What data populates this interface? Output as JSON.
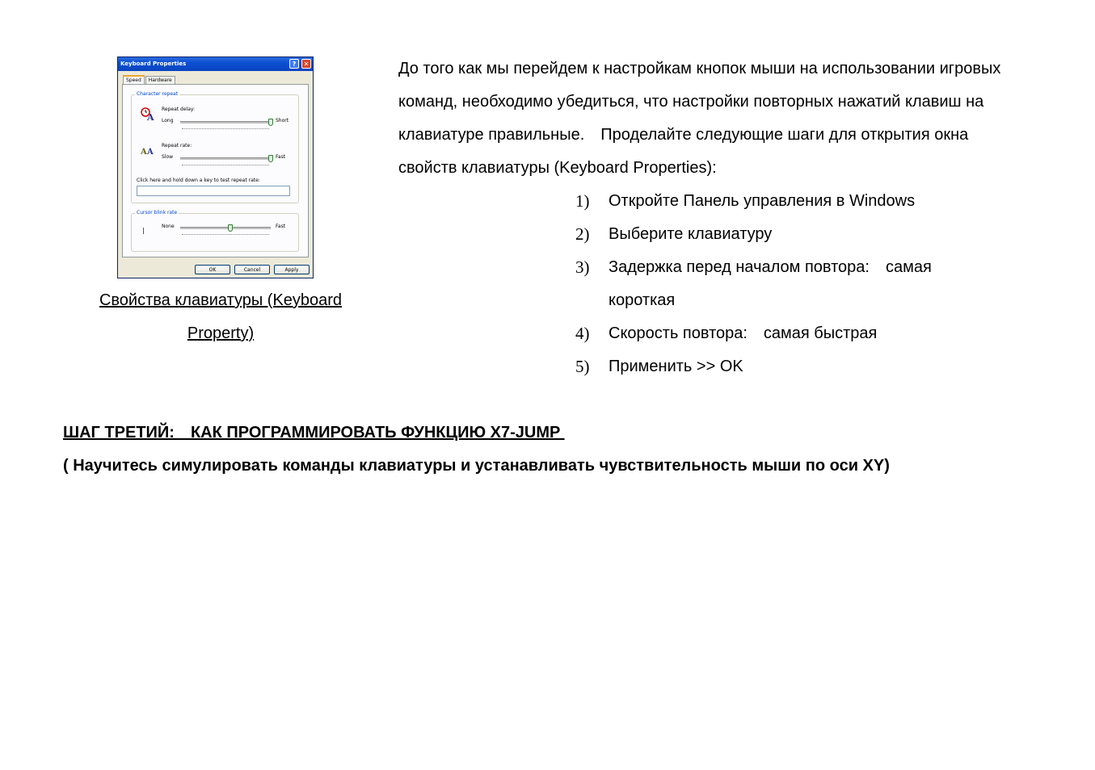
{
  "dialog": {
    "title": "Keyboard Properties",
    "help_glyph": "?",
    "close_glyph": "✕",
    "tabs": [
      "Speed",
      "Hardware"
    ],
    "character_repeat": {
      "group_label": "Character repeat",
      "repeat_delay_label": "Repeat delay:",
      "delay_min_label": "Long",
      "delay_max_label": "Short",
      "delay_level": 1.0,
      "repeat_rate_label": "Repeat rate:",
      "rate_min_label": "Slow",
      "rate_max_label": "Fast",
      "rate_level": 1.0,
      "test_label": "Click here and hold down a key to test repeat rate:",
      "delay_icon": "clock-letter-icon",
      "rate_icon": "repeated-letters-icon"
    },
    "cursor_blink": {
      "group_label": "Cursor blink rate",
      "min_label": "None",
      "max_label": "Fast",
      "cursor_glyph": "|",
      "blink_level": 0.55
    },
    "buttons": {
      "ok": "OK",
      "cancel": "Cancel",
      "apply": "Apply"
    }
  },
  "caption": {
    "line1": "Свойства клавиатуры (Keyboard ",
    "line2": "Property)"
  },
  "intro": "До того как мы перейдем к настройкам кнопок мыши на использовании игровых команд, необходимо убедиться, что настройки повторных нажатий клавиш на клавиатуре правильные.　Проделайте следующие шаги для открытия окна свойств клавиатуры (Keyboard Properties):",
  "steps": [
    {
      "num": "1)",
      "text": "Откройте Панель управления в Windows"
    },
    {
      "num": "2)",
      "text": "Выберите клавиатуру"
    },
    {
      "num": "3)",
      "text": "Задержка перед началом повтора:　самая короткая"
    },
    {
      "num": "4)",
      "text": "Скорость повтора:　самая быстрая"
    },
    {
      "num": "5)",
      "text": "Применить >> OK"
    }
  ],
  "section": {
    "heading": "ШАГ ТРЕТИЙ:　КАК ПРОГРАММИРОВАТЬ ФУНКЦИЮ X7-JUMP ",
    "subheading": "( Научитесь симулировать команды клавиатуры и устанавливать чувствительность мыши по оси XY)"
  }
}
